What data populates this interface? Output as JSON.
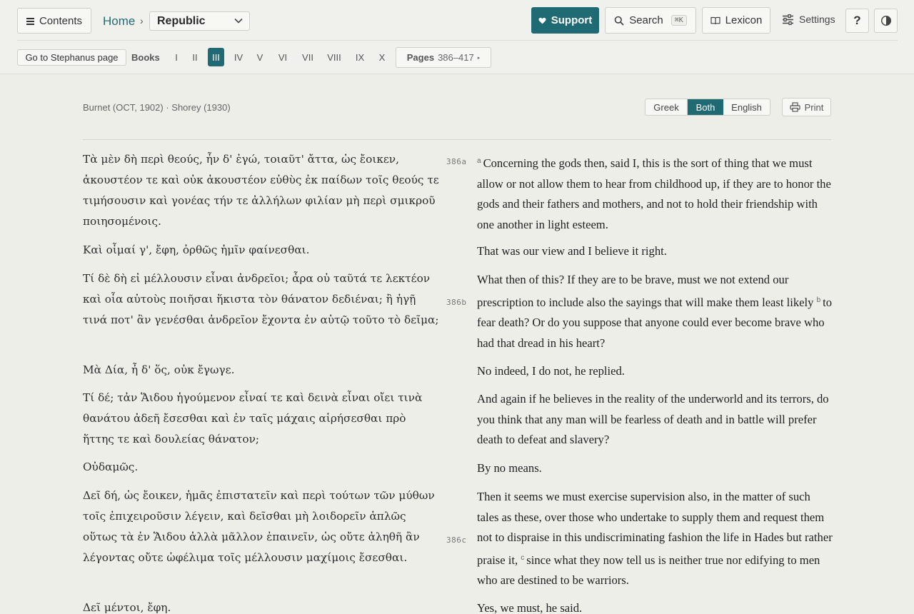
{
  "header": {
    "contents_label": "Contents",
    "breadcrumb_home": "Home",
    "breadcrumb_sep": "›",
    "work_select": "Republic",
    "support_label": "Support",
    "search_label": "Search",
    "search_shortcut": "⌘K",
    "lexicon_label": "Lexicon",
    "settings_label": "Settings",
    "help_label": "?",
    "accent_color": "#1f6a73"
  },
  "nav": {
    "goto_label": "Go to Stephanus page",
    "books_label": "Books",
    "books": [
      "I",
      "II",
      "III",
      "IV",
      "V",
      "VI",
      "VII",
      "VIII",
      "IX",
      "X"
    ],
    "active_book": "III",
    "pages_label": "Pages",
    "pages_range": "386–417",
    "pages_toggle": "▸"
  },
  "text": {
    "source": "Burnet (OCT, 1902) · Shorey (1930)",
    "view_modes": [
      "Greek",
      "Both",
      "English"
    ],
    "active_view": "Both",
    "print_label": "Print",
    "margin_refs": [
      "386a",
      "386b",
      "386c"
    ],
    "sections": [
      "a",
      "b",
      "c"
    ],
    "paragraphs": [
      {
        "greek": "Τὰ μὲν δὴ περὶ θεούς, ἦν δ' ἐγώ, τοιαῦτ' ἄττα, ὡς ἔοικεν, ἀκουστέον τε καὶ οὐκ ἀκουστέον εὐθὺς ἐκ παίδων τοῖς θεούς τε τιμήσουσιν καὶ γονέας τήν τε ἀλλήλων φιλίαν μὴ περὶ σμικροῦ ποιησομένοις.",
        "english": "Concerning the gods then, said I, this is the sort of thing that we must allow or not allow them to hear from childhood up, if they are to honor the gods and their fathers and mothers, and not to hold their friendship with one another in light esteem."
      },
      {
        "greek": "Καὶ οἶμαί γ', ἔφη, ὀρθῶς ἡμῖν φαίνεσθαι.",
        "english": "That was our view and I believe it right."
      },
      {
        "greek": "Τί δὲ δὴ εἰ μέλλουσιν εἶναι ἀνδρεῖοι; ἆρα οὐ ταῦτά τε λεκτέον καὶ οἷα αὐτοὺς ποιῆσαι ἥκιστα τὸν θάνατον δεδιέναι; ἢ ἡγῇ τινά ποτ' ἂν γενέσθαι ἀνδρεῖον ἔχοντα ἐν αὑτῷ τοῦτο τὸ δεῖμα;",
        "english_a": "What then of this? If they are to be brave, must we not extend our prescription to include also the sayings that will make them least likely",
        "english_b": "to fear death? Or do you suppose that anyone could ever become brave who had that dread in his heart?"
      },
      {
        "greek": "Μὰ Δία, ἦ δ' ὅς, οὐκ ἔγωγε.",
        "english": "No indeed, I do not, he replied."
      },
      {
        "greek": "Τί δέ; τἀν Ἅιδου ἡγούμενον εἶναί τε καὶ δεινὰ εἶναι οἴει τινὰ θανάτου ἀδεῆ ἔσεσθαι καὶ ἐν ταῖς μάχαις αἱρήσεσθαι πρὸ ἥττης τε καὶ δουλείας θάνατον;",
        "english": "And again if he believes in the reality of the underworld and its terrors, do you think that any man will be fearless of death and in battle will prefer death to defeat and slavery?"
      },
      {
        "greek": "Οὐδαμῶς.",
        "english": "By no means."
      },
      {
        "greek": "Δεῖ δή, ὡς ἔοικεν, ἡμᾶς ἐπιστατεῖν καὶ περὶ τούτων τῶν μύθων τοῖς ἐπιχειροῦσιν λέγειν, καὶ δεῖσθαι μὴ λοιδορεῖν ἁπλῶς οὕτως τὰ ἐν Ἅιδου ἀλλὰ μᾶλλον ἐπαινεῖν, ὡς οὔτε ἀληθῆ ἂν λέγοντας οὔτε ὠφέλιμα τοῖς μέλλουσιν μαχίμοις ἔσεσθαι.",
        "english_a": "Then it seems we must exercise supervision also, in the matter of such tales as these, over those who undertake to supply them and request them not to dispraise in this undiscriminating fashion the life in Hades but rather praise it,",
        "english_b": "since what they now tell us is neither true nor edifying to men who are destined to be warriors."
      },
      {
        "greek": "Δεῖ μέντοι, ἔφη.",
        "english": "Yes, we must, he said."
      }
    ]
  }
}
